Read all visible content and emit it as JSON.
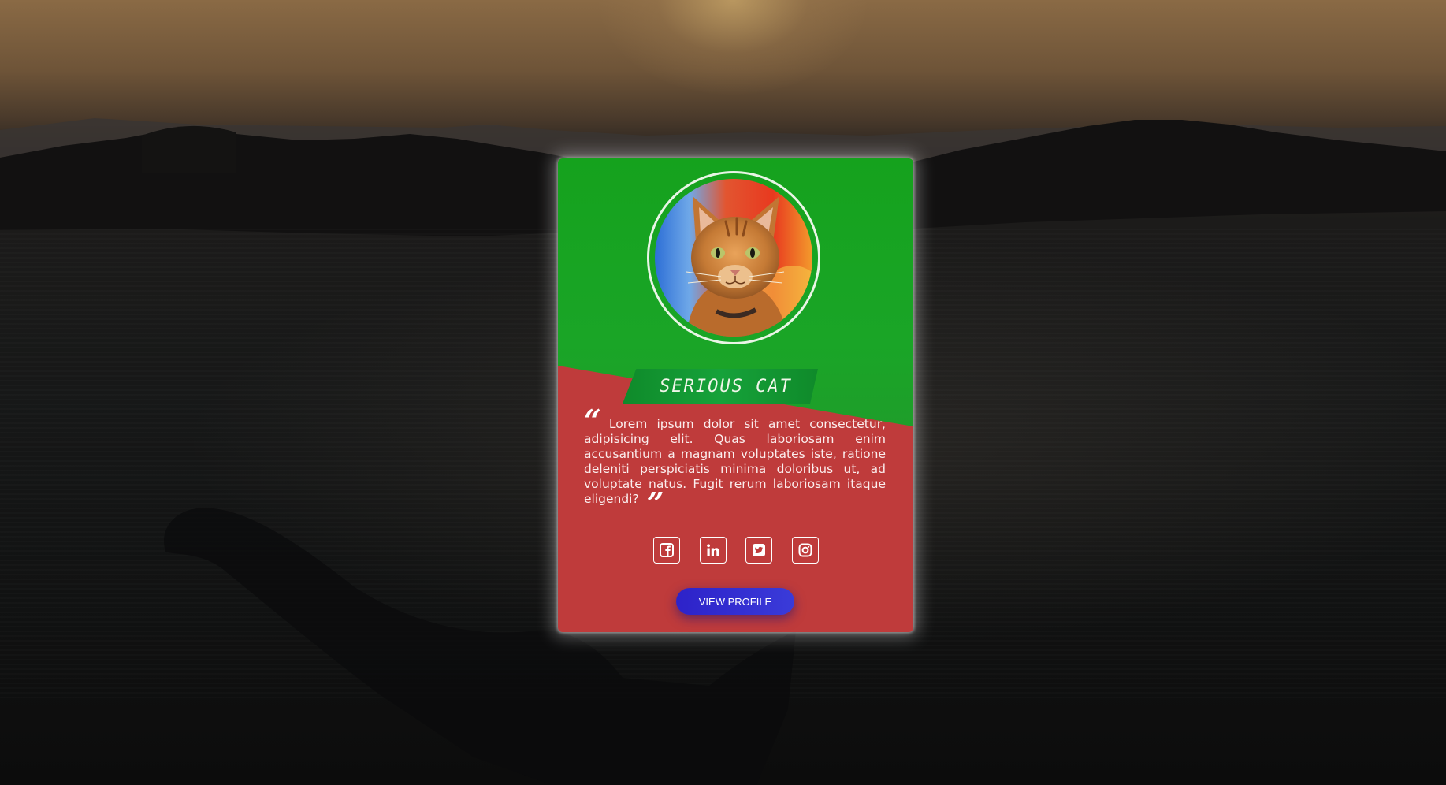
{
  "profile": {
    "name": "SERIOUS CAT",
    "quote": "Lorem ipsum dolor sit amet consectetur, adipisicing elit. Quas laboriosam enim accusantium a magnam voluptates iste, ratione deleniti perspiciatis minima doloribus ut, ad voluptate natus. Fugit rerum laboriosam itaque eligendi?",
    "view_button_label": "VIEW PROFILE"
  },
  "socials": [
    {
      "icon": "facebook-icon"
    },
    {
      "icon": "linkedin-icon"
    },
    {
      "icon": "twitter-icon"
    },
    {
      "icon": "instagram-icon"
    }
  ],
  "colors": {
    "card_top": "#15a21d",
    "card_bottom": "#bf3b3b",
    "banner": "#16a23a",
    "button": "#2d22c9"
  }
}
